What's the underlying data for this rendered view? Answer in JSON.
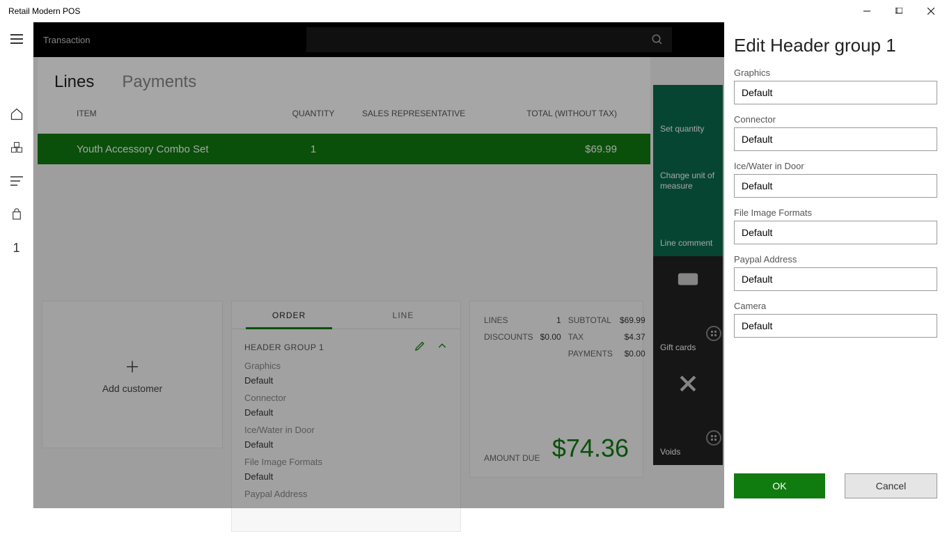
{
  "window": {
    "title": "Retail Modern POS"
  },
  "topbar": {
    "title": "Transaction"
  },
  "rail": {
    "badge": "1"
  },
  "tabs": {
    "lines": "Lines",
    "payments": "Payments"
  },
  "grid": {
    "headers": {
      "item": "ITEM",
      "qty": "QUANTITY",
      "rep": "SALES REPRESENTATIVE",
      "total": "TOTAL (WITHOUT TAX)"
    },
    "rows": [
      {
        "item": "Youth Accessory Combo Set",
        "qty": "1",
        "rep": "",
        "total": "$69.99"
      }
    ]
  },
  "add_customer": {
    "label": "Add customer"
  },
  "order_card": {
    "tabs": {
      "order": "ORDER",
      "line": "LINE"
    },
    "group_title": "HEADER GROUP 1",
    "fields": [
      {
        "k": "Graphics",
        "v": "Default"
      },
      {
        "k": "Connector",
        "v": "Default"
      },
      {
        "k": "Ice/Water in Door",
        "v": "Default"
      },
      {
        "k": "File Image Formats",
        "v": "Default"
      },
      {
        "k": "Paypal Address",
        "v": ""
      }
    ]
  },
  "totals": {
    "lines_l": "LINES",
    "lines_v": "1",
    "disc_l": "DISCOUNTS",
    "disc_v": "$0.00",
    "sub_l": "SUBTOTAL",
    "sub_v": "$69.99",
    "tax_l": "TAX",
    "tax_v": "$4.37",
    "pay_l": "PAYMENTS",
    "pay_v": "$0.00",
    "due_l": "AMOUNT DUE",
    "due_v": "$74.36"
  },
  "tiles": {
    "set_qty": "Set quantity",
    "uom": "Change unit of measure",
    "comment": "Line comment",
    "gift": "Gift cards",
    "voids": "Voids"
  },
  "panel": {
    "title": "Edit Header group 1",
    "fields": [
      {
        "label": "Graphics",
        "value": "Default"
      },
      {
        "label": "Connector",
        "value": "Default"
      },
      {
        "label": "Ice/Water in Door",
        "value": "Default"
      },
      {
        "label": "File Image Formats",
        "value": "Default"
      },
      {
        "label": "Paypal Address",
        "value": "Default"
      },
      {
        "label": "Camera",
        "value": "Default"
      }
    ],
    "ok": "OK",
    "cancel": "Cancel"
  }
}
